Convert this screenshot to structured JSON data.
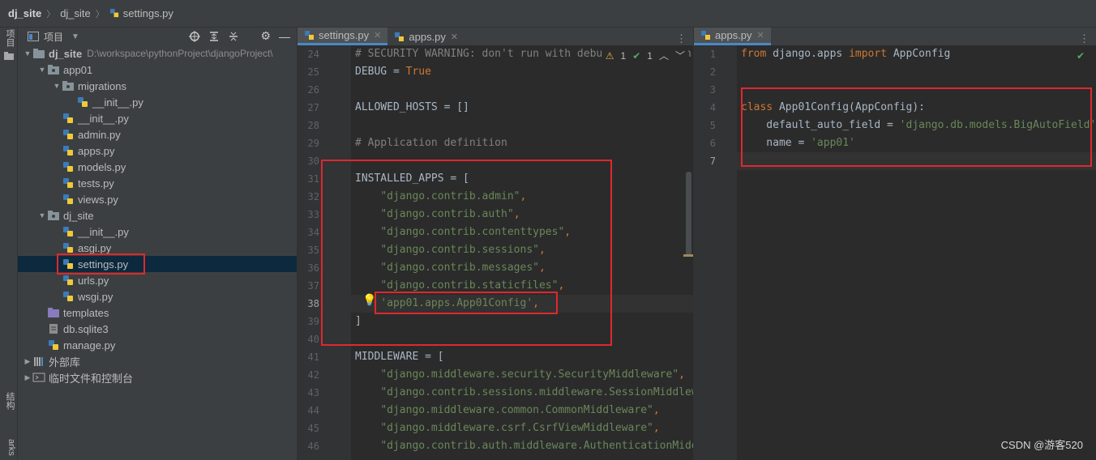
{
  "breadcrumb": {
    "root": "dj_site",
    "folder": "dj_site",
    "file": "settings.py"
  },
  "left_strip": {
    "project_tab": "项目",
    "structure_tab": "结构",
    "bookmarks_tab": "arks"
  },
  "project_panel": {
    "title": "项目",
    "tree": [
      {
        "label": "dj_site",
        "path": "D:\\workspace\\pythonProject\\djangoProject\\",
        "depth": 0,
        "expanded": true,
        "kind": "folder",
        "bold": true
      },
      {
        "label": "app01",
        "depth": 1,
        "expanded": true,
        "kind": "package"
      },
      {
        "label": "migrations",
        "depth": 2,
        "expanded": true,
        "kind": "package"
      },
      {
        "label": "__init__.py",
        "depth": 3,
        "kind": "py"
      },
      {
        "label": "__init__.py",
        "depth": 2,
        "kind": "py"
      },
      {
        "label": "admin.py",
        "depth": 2,
        "kind": "py"
      },
      {
        "label": "apps.py",
        "depth": 2,
        "kind": "py"
      },
      {
        "label": "models.py",
        "depth": 2,
        "kind": "py"
      },
      {
        "label": "tests.py",
        "depth": 2,
        "kind": "py"
      },
      {
        "label": "views.py",
        "depth": 2,
        "kind": "py"
      },
      {
        "label": "dj_site",
        "depth": 1,
        "expanded": true,
        "kind": "package"
      },
      {
        "label": "__init__.py",
        "depth": 2,
        "kind": "py"
      },
      {
        "label": "asgi.py",
        "depth": 2,
        "kind": "py"
      },
      {
        "label": "settings.py",
        "depth": 2,
        "kind": "py",
        "selected": true
      },
      {
        "label": "urls.py",
        "depth": 2,
        "kind": "py"
      },
      {
        "label": "wsgi.py",
        "depth": 2,
        "kind": "py"
      },
      {
        "label": "templates",
        "depth": 1,
        "kind": "folder-purple"
      },
      {
        "label": "db.sqlite3",
        "depth": 1,
        "kind": "db"
      },
      {
        "label": "manage.py",
        "depth": 1,
        "kind": "py"
      },
      {
        "label": "外部库",
        "depth": 0,
        "expanded": false,
        "kind": "lib"
      },
      {
        "label": "临时文件和控制台",
        "depth": 0,
        "expanded": false,
        "kind": "scratch"
      }
    ]
  },
  "editor_left": {
    "tabs": [
      {
        "label": "settings.py",
        "active": true
      },
      {
        "label": "apps.py",
        "active": false
      }
    ],
    "inspection": {
      "warnings": "1",
      "ok": "1"
    },
    "current_line": "38",
    "lines": [
      {
        "n": "24",
        "tokens": [
          {
            "t": "# SECURITY WARNING: don't run with debug turned on in production!",
            "c": "com"
          }
        ]
      },
      {
        "n": "25",
        "tokens": [
          {
            "t": "DEBUG = ",
            "c": "id"
          },
          {
            "t": "True",
            "c": "kw"
          }
        ]
      },
      {
        "n": "26",
        "tokens": []
      },
      {
        "n": "27",
        "tokens": [
          {
            "t": "ALLOWED_HOSTS = []",
            "c": "id"
          }
        ]
      },
      {
        "n": "28",
        "tokens": []
      },
      {
        "n": "29",
        "tokens": [
          {
            "t": "# Application definition",
            "c": "com"
          }
        ]
      },
      {
        "n": "30",
        "tokens": []
      },
      {
        "n": "31",
        "tokens": [
          {
            "t": "INSTALLED_APPS = [",
            "c": "id"
          }
        ]
      },
      {
        "n": "32",
        "tokens": [
          {
            "t": "    ",
            "c": "id"
          },
          {
            "t": "\"django.contrib.admin\"",
            "c": "str"
          },
          {
            "t": ",",
            "c": "kw"
          }
        ]
      },
      {
        "n": "33",
        "tokens": [
          {
            "t": "    ",
            "c": "id"
          },
          {
            "t": "\"django.contrib.auth\"",
            "c": "str"
          },
          {
            "t": ",",
            "c": "kw"
          }
        ]
      },
      {
        "n": "34",
        "tokens": [
          {
            "t": "    ",
            "c": "id"
          },
          {
            "t": "\"django.contrib.contenttypes\"",
            "c": "str"
          },
          {
            "t": ",",
            "c": "kw"
          }
        ]
      },
      {
        "n": "35",
        "tokens": [
          {
            "t": "    ",
            "c": "id"
          },
          {
            "t": "\"django.contrib.sessions\"",
            "c": "str"
          },
          {
            "t": ",",
            "c": "kw"
          }
        ]
      },
      {
        "n": "36",
        "tokens": [
          {
            "t": "    ",
            "c": "id"
          },
          {
            "t": "\"django.contrib.messages\"",
            "c": "str"
          },
          {
            "t": ",",
            "c": "kw"
          }
        ]
      },
      {
        "n": "37",
        "tokens": [
          {
            "t": "    ",
            "c": "id"
          },
          {
            "t": "\"django.contrib.staticfiles\"",
            "c": "str"
          },
          {
            "t": ",",
            "c": "kw"
          }
        ]
      },
      {
        "n": "38",
        "tokens": [
          {
            "t": "    ",
            "c": "id"
          },
          {
            "t": "'app01.apps.App01Config'",
            "c": "str"
          },
          {
            "t": ",",
            "c": "kw"
          }
        ]
      },
      {
        "n": "39",
        "tokens": [
          {
            "t": "]",
            "c": "id"
          }
        ]
      },
      {
        "n": "40",
        "tokens": []
      },
      {
        "n": "41",
        "tokens": [
          {
            "t": "MIDDLEWARE = [",
            "c": "id"
          }
        ]
      },
      {
        "n": "42",
        "tokens": [
          {
            "t": "    ",
            "c": "id"
          },
          {
            "t": "\"django.middleware.security.SecurityMiddleware\"",
            "c": "str"
          },
          {
            "t": ",",
            "c": "kw"
          }
        ]
      },
      {
        "n": "43",
        "tokens": [
          {
            "t": "    ",
            "c": "id"
          },
          {
            "t": "\"django.contrib.sessions.middleware.SessionMiddleware\"",
            "c": "str"
          },
          {
            "t": ",",
            "c": "kw"
          }
        ]
      },
      {
        "n": "44",
        "tokens": [
          {
            "t": "    ",
            "c": "id"
          },
          {
            "t": "\"django.middleware.common.CommonMiddleware\"",
            "c": "str"
          },
          {
            "t": ",",
            "c": "kw"
          }
        ]
      },
      {
        "n": "45",
        "tokens": [
          {
            "t": "    ",
            "c": "id"
          },
          {
            "t": "\"django.middleware.csrf.CsrfViewMiddleware\"",
            "c": "str"
          },
          {
            "t": ",",
            "c": "kw"
          }
        ]
      },
      {
        "n": "46",
        "tokens": [
          {
            "t": "    ",
            "c": "id"
          },
          {
            "t": "\"django.contrib.auth.middleware.AuthenticationMiddleware\"",
            "c": "str"
          },
          {
            "t": ",",
            "c": "kw"
          }
        ]
      }
    ]
  },
  "editor_right": {
    "tabs": [
      {
        "label": "apps.py",
        "active": true
      }
    ],
    "current_line": "7",
    "lines": [
      {
        "n": "1",
        "tokens": [
          {
            "t": "from ",
            "c": "kw"
          },
          {
            "t": "django.apps ",
            "c": "id"
          },
          {
            "t": "import ",
            "c": "kw"
          },
          {
            "t": "AppConfig",
            "c": "id"
          }
        ]
      },
      {
        "n": "2",
        "tokens": []
      },
      {
        "n": "3",
        "tokens": []
      },
      {
        "n": "4",
        "tokens": [
          {
            "t": "class ",
            "c": "kw"
          },
          {
            "t": "App01Config(AppConfig):",
            "c": "id"
          }
        ]
      },
      {
        "n": "5",
        "tokens": [
          {
            "t": "    default_auto_field = ",
            "c": "id"
          },
          {
            "t": "'django.db.models.BigAutoField'",
            "c": "str"
          }
        ]
      },
      {
        "n": "6",
        "tokens": [
          {
            "t": "    name = ",
            "c": "id"
          },
          {
            "t": "'app01'",
            "c": "str"
          }
        ]
      },
      {
        "n": "7",
        "tokens": []
      }
    ]
  },
  "watermark": "CSDN @游客520",
  "colors": {
    "highlight": "#e0282d",
    "selection": "#0d293e",
    "accent_tab": "#4a88c7"
  }
}
